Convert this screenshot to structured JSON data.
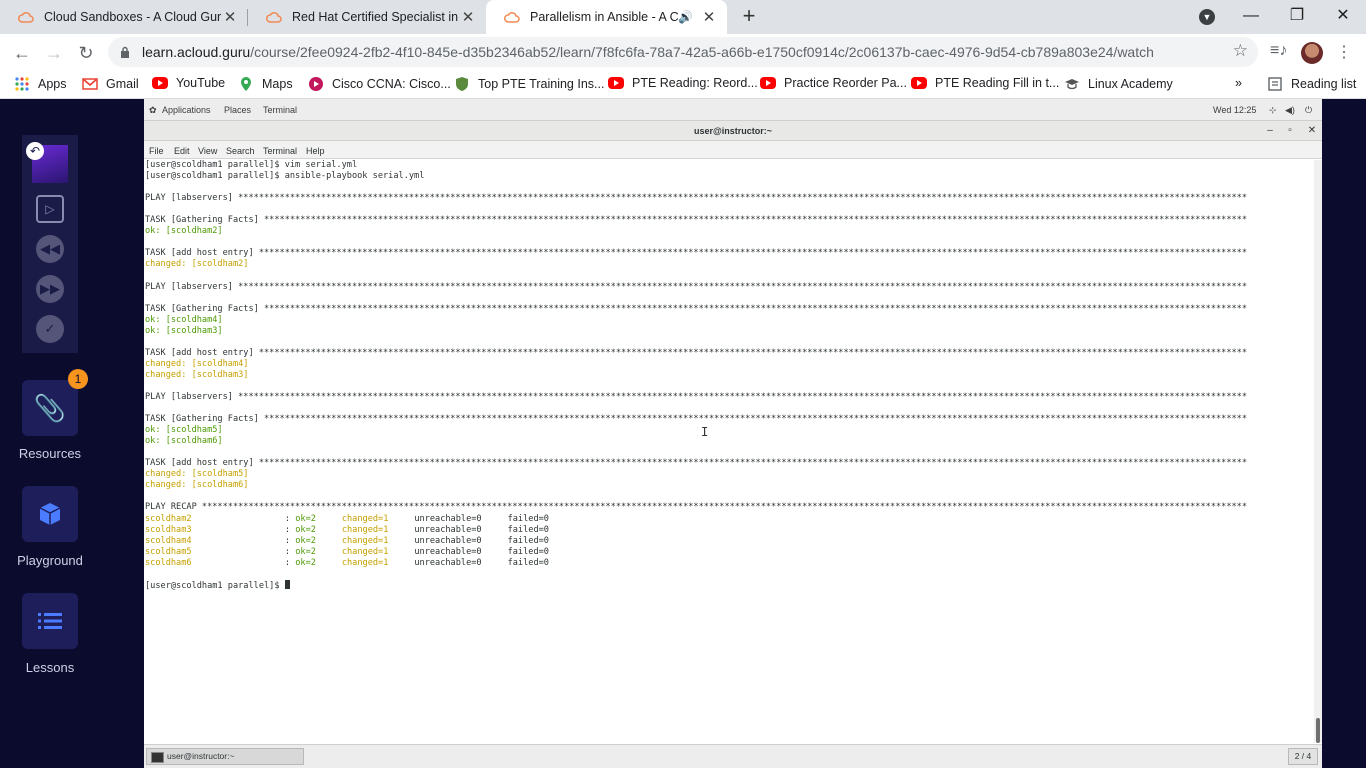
{
  "browser": {
    "tabs": [
      {
        "title": "Cloud Sandboxes - A Cloud Guru",
        "active": false
      },
      {
        "title": "Red Hat Certified Specialist in An",
        "active": false
      },
      {
        "title": "Parallelism in Ansible - A Clo",
        "active": true
      }
    ],
    "new_tab_label": "+",
    "window_controls": {
      "minimize": "—",
      "maximize": "❐",
      "close": "✕"
    },
    "url_host": "learn.acloud.guru",
    "url_path": "/course/2fee0924-2fb2-4f10-845e-d35b2346ab52/learn/7f8fc6fa-78a7-42a5-a66b-e1750cf0914c/2c06137b-caec-4976-9d54-cb789a803e24/watch",
    "bookmarks": [
      "Apps",
      "Gmail",
      "YouTube",
      "Maps",
      "Cisco CCNA: Cisco...",
      "Top PTE Training Ins...",
      "PTE Reading: Reord...",
      "Practice Reorder Pa...",
      "PTE Reading Fill in t...",
      "Linux Academy"
    ],
    "more_bookmarks": "»",
    "reading_list": "Reading list"
  },
  "course_nav": {
    "resources_label": "Resources",
    "resources_badge": "1",
    "playground_label": "Playground",
    "lessons_label": "Lessons"
  },
  "desktop": {
    "top_bar": {
      "applications": "Applications",
      "places": "Places",
      "terminal": "Terminal",
      "clock": "Wed 12:25"
    },
    "window_title": "user@instructor:~",
    "menu": [
      "File",
      "Edit",
      "View",
      "Search",
      "Terminal",
      "Help"
    ],
    "taskbar_item": "user@instructor:~",
    "workspace": "2 / 4"
  },
  "terminal_lines": [
    {
      "t": "[user@scoldham1 parallel]$ vim serial.yml",
      "c": ""
    },
    {
      "t": "[user@scoldham1 parallel]$ ansible-playbook serial.yml",
      "c": ""
    },
    {
      "t": "",
      "c": ""
    },
    {
      "t": "PLAY [labservers] ***************************************************************************************************************************************************************************************************",
      "c": ""
    },
    {
      "t": "",
      "c": ""
    },
    {
      "t": "TASK [Gathering Facts] **********************************************************************************************************************************************************************************************",
      "c": ""
    },
    {
      "t": "ok: [scoldham2]",
      "c": "ok"
    },
    {
      "t": "",
      "c": ""
    },
    {
      "t": "TASK [add host entry] ***********************************************************************************************************************************************************************************************",
      "c": ""
    },
    {
      "t": "changed: [scoldham2]",
      "c": "ch"
    },
    {
      "t": "",
      "c": ""
    },
    {
      "t": "PLAY [labservers] ***************************************************************************************************************************************************************************************************",
      "c": ""
    },
    {
      "t": "",
      "c": ""
    },
    {
      "t": "TASK [Gathering Facts] **********************************************************************************************************************************************************************************************",
      "c": ""
    },
    {
      "t": "ok: [scoldham4]",
      "c": "ok"
    },
    {
      "t": "ok: [scoldham3]",
      "c": "ok"
    },
    {
      "t": "",
      "c": ""
    },
    {
      "t": "TASK [add host entry] ***********************************************************************************************************************************************************************************************",
      "c": ""
    },
    {
      "t": "changed: [scoldham4]",
      "c": "ch"
    },
    {
      "t": "changed: [scoldham3]",
      "c": "ch"
    },
    {
      "t": "",
      "c": ""
    },
    {
      "t": "PLAY [labservers] ***************************************************************************************************************************************************************************************************",
      "c": ""
    },
    {
      "t": "",
      "c": ""
    },
    {
      "t": "TASK [Gathering Facts] **********************************************************************************************************************************************************************************************",
      "c": ""
    },
    {
      "t": "ok: [scoldham5]",
      "c": "ok"
    },
    {
      "t": "ok: [scoldham6]",
      "c": "ok"
    },
    {
      "t": "",
      "c": ""
    },
    {
      "t": "TASK [add host entry] ***********************************************************************************************************************************************************************************************",
      "c": ""
    },
    {
      "t": "changed: [scoldham5]",
      "c": "ch"
    },
    {
      "t": "changed: [scoldham6]",
      "c": "ch"
    },
    {
      "t": "",
      "c": ""
    },
    {
      "t": "PLAY RECAP **********************************************************************************************************************************************************************************************************",
      "c": ""
    }
  ],
  "recap": [
    {
      "host": "scoldham2",
      "ok": "ok=2",
      "changed": "changed=1",
      "unreachable": "unreachable=0",
      "failed": "failed=0"
    },
    {
      "host": "scoldham3",
      "ok": "ok=2",
      "changed": "changed=1",
      "unreachable": "unreachable=0",
      "failed": "failed=0"
    },
    {
      "host": "scoldham4",
      "ok": "ok=2",
      "changed": "changed=1",
      "unreachable": "unreachable=0",
      "failed": "failed=0"
    },
    {
      "host": "scoldham5",
      "ok": "ok=2",
      "changed": "changed=1",
      "unreachable": "unreachable=0",
      "failed": "failed=0"
    },
    {
      "host": "scoldham6",
      "ok": "ok=2",
      "changed": "changed=1",
      "unreachable": "unreachable=0",
      "failed": "failed=0"
    }
  ],
  "prompt": "[user@scoldham1 parallel]$ ",
  "colors": {
    "ok": "#4e9a06",
    "changed": "#c4a000",
    "nav_bg": "#0b0b2e",
    "accent": "#4b7cff",
    "badge": "#f7941d"
  }
}
